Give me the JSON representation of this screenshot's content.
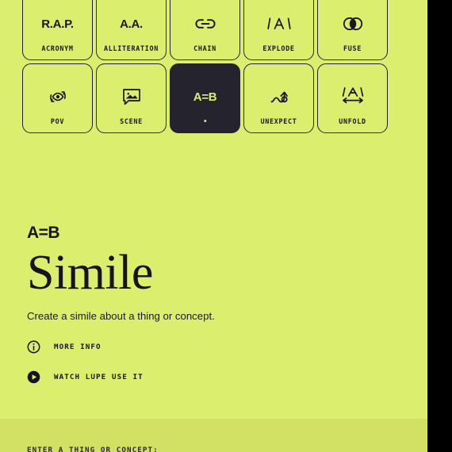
{
  "theme": {
    "background": "#dcee6e",
    "panel_background": "#d2e064",
    "ink": "#16141d",
    "selected_tile_background": "#25232e",
    "selected_tile_ink": "#dcee6e",
    "outside_background": "#000000"
  },
  "tiles": [
    {
      "label": "ACRONYM",
      "icon": "rap-text-icon",
      "glyph": "R.A.P.",
      "selected": false
    },
    {
      "label": "ALLITERATION",
      "icon": "aa-text-icon",
      "glyph": "A.A.",
      "selected": false
    },
    {
      "label": "CHAIN",
      "icon": "link-chain-icon",
      "glyph": "",
      "selected": false
    },
    {
      "label": "EXPLODE",
      "icon": "explode-letter-a-icon",
      "glyph": "/A\\",
      "selected": false
    },
    {
      "label": "FUSE",
      "icon": "venn-circles-icon",
      "glyph": "",
      "selected": false
    },
    {
      "label": "POV",
      "icon": "rotating-eye-icon",
      "glyph": "",
      "selected": false
    },
    {
      "label": "SCENE",
      "icon": "picture-bubble-icon",
      "glyph": "",
      "selected": false
    },
    {
      "label": "",
      "icon": "a-equals-b-icon",
      "glyph": "A=B",
      "selected": true
    },
    {
      "label": "UNEXPECT",
      "icon": "squiggly-arrow-icon",
      "glyph": "",
      "selected": false
    },
    {
      "label": "UNFOLD",
      "icon": "unfold-letter-a-icon",
      "glyph": "\\A/",
      "selected": false
    }
  ],
  "detail": {
    "eyebrow": "A=B",
    "title": "Simile",
    "description": "Create a simile about a thing or concept.",
    "links": [
      {
        "label": "MORE INFO",
        "icon": "info-circle-icon"
      },
      {
        "label": "WATCH LUPE USE IT",
        "icon": "play-circle-icon"
      }
    ]
  },
  "input_panel": {
    "label": "ENTER A THING OR CONCEPT:"
  }
}
